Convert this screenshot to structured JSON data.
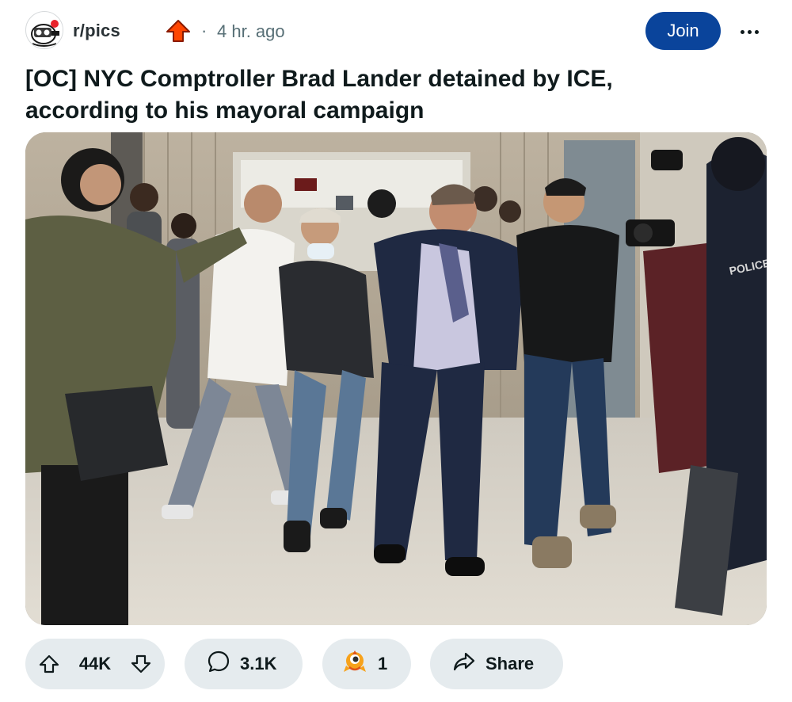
{
  "post": {
    "subreddit": "r/pics",
    "separator": "·",
    "time_ago": "4 hr. ago",
    "join_label": "Join",
    "title": "[OC] NYC Comptroller Brad Lander detained by ICE, according to his mayoral campaign",
    "image_alt": "Photo of a man in a suit being detained in a hallway surrounded by people and photographers"
  },
  "actions": {
    "upvotes": "44K",
    "comments": "3.1K",
    "awards": "1",
    "share_label": "Share"
  },
  "icons": {
    "avatar": "subreddit-avatar-icon",
    "flair": "upvote-arrow-icon",
    "more": "more-options-icon",
    "upvote": "upvote-icon",
    "downvote": "downvote-icon",
    "comment": "comment-icon",
    "award": "award-icon",
    "share": "share-icon"
  },
  "colors": {
    "join_button": "#0a449b",
    "pill_background": "#e5ebee",
    "flair_red": "#ff4500",
    "meta_text": "#576f76"
  }
}
